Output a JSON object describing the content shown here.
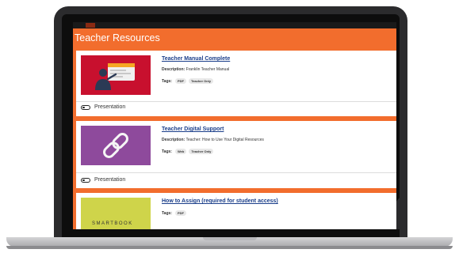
{
  "header": {
    "title": "Teacher Resources"
  },
  "resources": [
    {
      "title": "Teacher Manual Complete",
      "description_label": "Description:",
      "description": "Franklin Teacher Manual",
      "tags_label": "Tags:",
      "tags": [
        "PDF",
        "Teacher Only"
      ],
      "toggle_label": "Presentation",
      "thumb_icon": "presenter-icon",
      "thumb_color": "#c8102e"
    },
    {
      "title": "Teacher Digital Support",
      "description_label": "Description:",
      "description": "Teacher: How to Use Your Digital Resources",
      "tags_label": "Tags:",
      "tags": [
        "Web",
        "Teacher Only"
      ],
      "toggle_label": "Presentation",
      "thumb_icon": "link-icon",
      "thumb_color": "#8e4a9c"
    },
    {
      "title": "How to Assign (required for student access)",
      "tags_label": "Tags:",
      "tags": [
        "PDF"
      ],
      "thumb_text": "SMARTBOOK",
      "thumb_icon": "smartbook-logo",
      "thumb_color": "#cfd44a"
    }
  ],
  "colors": {
    "accent": "#f26d2d",
    "link": "#1a3e8a"
  }
}
